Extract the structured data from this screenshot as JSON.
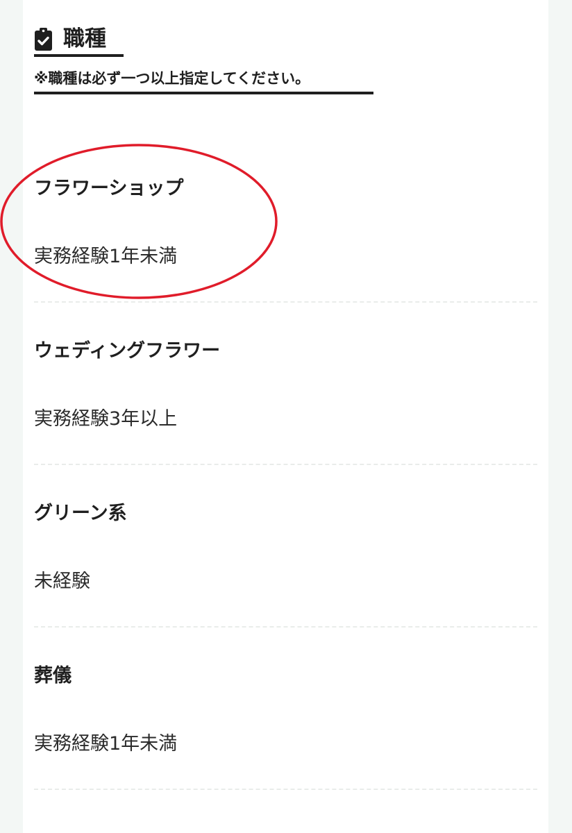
{
  "section": {
    "title": "職種",
    "icon": "clipboard-check-icon",
    "note": "※職種は必ず一つ以上指定してください。"
  },
  "jobs": [
    {
      "name": "フラワーショップ",
      "experience": "実務経験1年未満"
    },
    {
      "name": "ウェディングフラワー",
      "experience": "実務経験3年以上"
    },
    {
      "name": "グリーン系",
      "experience": "未経験"
    },
    {
      "name": "葬儀",
      "experience": "実務経験1年未満"
    }
  ],
  "colors": {
    "background": "#f3f7f5",
    "text": "#1f1f1f",
    "annotation": "#e01c2a"
  }
}
